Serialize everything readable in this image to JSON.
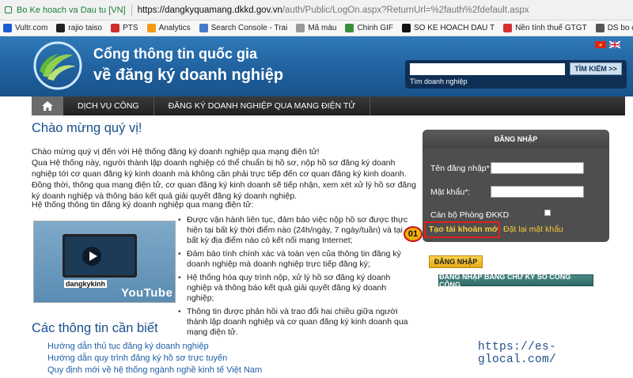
{
  "browser": {
    "secure_label": "Bo Ke hoach va Dau tu [VN]",
    "url_host": "https://dangkyquamang.dkkd.gov.vn",
    "url_path": "/auth/Public/LogOn.aspx?ReturnUrl=%2fauth%2fdefault.aspx"
  },
  "bookmarks": [
    {
      "label": "Vultr.com",
      "color": "#1b5bd1"
    },
    {
      "label": "rajio taiso",
      "color": "#222222"
    },
    {
      "label": "PTS",
      "color": "#d12c2c"
    },
    {
      "label": "Analytics",
      "color": "#f29c11"
    },
    {
      "label": "Search Console - Trai",
      "color": "#4a78c9"
    },
    {
      "label": "Mã màu",
      "color": "#999999"
    },
    {
      "label": "Chinh GIF",
      "color": "#3a8d3a"
    },
    {
      "label": "SO KE HOACH DAU T",
      "color": "#111111"
    },
    {
      "label": "Nền tính thuế GTGT",
      "color": "#d62f2f"
    },
    {
      "label": "DS bo cai misa",
      "color": "#555555"
    }
  ],
  "header": {
    "title_line1": "Cổng thông tin quốc gia",
    "title_line2": "về đăng ký doanh nghiệp",
    "search_placeholder": "",
    "search_button": "TÌM KIẾM >>",
    "search_label": "Tìm doanh nghiệp"
  },
  "nav": {
    "items": [
      "DỊCH VỤ CÔNG",
      "ĐĂNG KÝ DOANH NGHIỆP QUA MẠNG ĐIỆN TỬ"
    ]
  },
  "main": {
    "welcome": "Chào mừng quý vị!",
    "p1": "Chào mừng quý vị đến với Hệ thống đăng ký doanh nghiệp qua mạng điện tử!",
    "p2": "Qua Hệ thống này, người thành lập doanh nghiệp có thể chuẩn bị hồ sơ, nộp hồ sơ đăng ký doanh nghiệp tới cơ quan đăng ký kinh doanh mà không cần phải trực tiếp đến cơ quan đăng ký kinh doanh. Đồng thời, thông qua mạng điện tử, cơ quan đăng ký kinh doanh sẽ tiếp nhận, xem xét xử lý hồ sơ đăng ký doanh nghiệp và thông báo kết quả giải quyết đăng ký doanh nghiệp.",
    "p3": "Hệ thống thông tin đăng ký doanh nghiệp qua mạng điện tử:",
    "bullets": [
      "Được vận hành liên tục, đảm bảo việc nộp hồ sơ được thực hiện tại bất kỳ thời điểm nào (24h/ngày, 7 ngày/tuần) và tại bất kỳ địa điểm nào có kết nối mạng Internet;",
      "Đảm bảo tính chính xác và toàn vẹn của thông tin đăng ký doanh nghiệp mà doanh nghiệp trực tiếp đăng ký;",
      "Hệ thống hóa quy trình nộp, xử lý hồ sơ đăng ký doanh nghiệp và thông báo kết quả giải quyết đăng ký doanh nghiệp;",
      "Thông tin được phản hồi và trao đổi hai chiều giữa người thành lập doanh nghiệp và cơ quan đăng ký kinh doanh qua mạng điện tử."
    ],
    "video_label": "dangkykinh",
    "video_brand": "YouTube",
    "info_title": "Các thông tin cần biết",
    "links": [
      "Hướng dẫn thủ tục đăng ký doanh nghiệp",
      "Hướng dẫn quy trình đăng ký hồ sơ trực tuyến",
      "Quy định mới về hệ thống ngành nghề kinh tế Việt Nam"
    ]
  },
  "login": {
    "title": "ĐĂNG NHẬP",
    "username_label": "Tên đăng nhập*:",
    "password_label": "Mật khẩu*:",
    "officer_label": "Cán bộ Phòng ĐKKD",
    "register_link": "Tạo tài khoản mới",
    "forgot_link": "Đặt lại mật khẩu",
    "login_button": "ĐĂNG NHẬP",
    "signature_button": "ĐĂNG NHẬP BẰNG CHỮ KÝ SỐ CÔNG CỘNG"
  },
  "annotation": {
    "badge": "01",
    "highlight_color": "#e0201f"
  },
  "watermark": "https://es-glocal.com/"
}
